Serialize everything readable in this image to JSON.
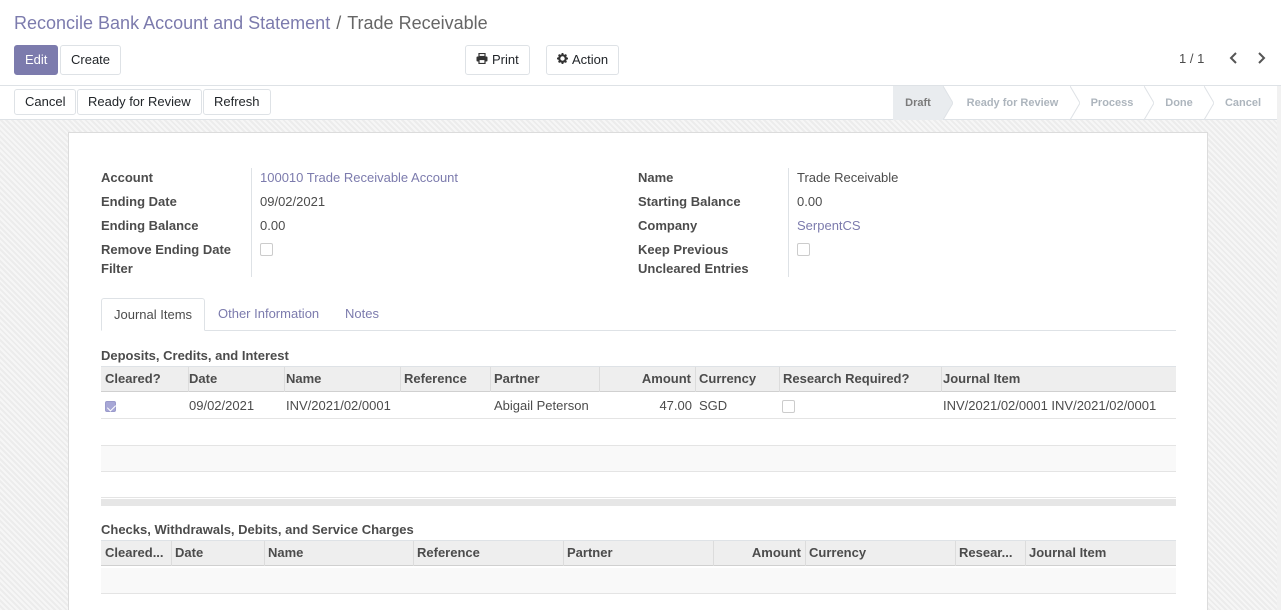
{
  "breadcrumb": {
    "parent": "Reconcile Bank Account and Statement",
    "separator": "/",
    "current": "Trade Receivable"
  },
  "toolbar": {
    "edit": "Edit",
    "create": "Create",
    "print": "Print",
    "action": "Action"
  },
  "pager": {
    "value": "1 / 1"
  },
  "statusbar": {
    "buttons": {
      "cancel": "Cancel",
      "ready": "Ready for Review",
      "refresh": "Refresh"
    },
    "stages": [
      "Draft",
      "Ready for Review",
      "Process",
      "Done",
      "Cancel"
    ],
    "active_stage": "Draft"
  },
  "form": {
    "account_label": "Account",
    "account_value": "100010 Trade Receivable Account",
    "ending_date_label": "Ending Date",
    "ending_date_value": "09/02/2021",
    "ending_balance_label": "Ending Balance",
    "ending_balance_value": "0.00",
    "remove_filter_label_1": "Remove Ending Date",
    "remove_filter_label_2": "Filter",
    "remove_filter_checked": false,
    "name_label": "Name",
    "name_value": "Trade Receivable",
    "starting_balance_label": "Starting Balance",
    "starting_balance_value": "0.00",
    "company_label": "Company",
    "company_value": "SerpentCS",
    "keep_prev_label_1": "Keep Previous",
    "keep_prev_label_2": "Uncleared Entries",
    "keep_prev_checked": false
  },
  "tabs": [
    "Journal Items",
    "Other Information",
    "Notes"
  ],
  "deposits": {
    "title": "Deposits, Credits, and Interest",
    "columns": [
      "Cleared?",
      "Date",
      "Name",
      "Reference",
      "Partner",
      "Amount",
      "Currency",
      "Research Required?",
      "Journal Item"
    ],
    "rows": [
      {
        "cleared": true,
        "date": "09/02/2021",
        "name": "INV/2021/02/0001",
        "reference": "",
        "partner": "Abigail Peterson",
        "amount": "47.00",
        "currency": "SGD",
        "research_required": false,
        "journal_item": "INV/2021/02/0001 INV/2021/02/0001"
      }
    ]
  },
  "checks": {
    "title": "Checks, Withdrawals, Debits, and Service Charges",
    "columns": [
      "Cleared...",
      "Date",
      "Name",
      "Reference",
      "Partner",
      "Amount",
      "Currency",
      "Resear...",
      "Journal Item"
    ]
  },
  "colors": {
    "accent": "#7c7bad",
    "text": "#4c4c4c"
  }
}
